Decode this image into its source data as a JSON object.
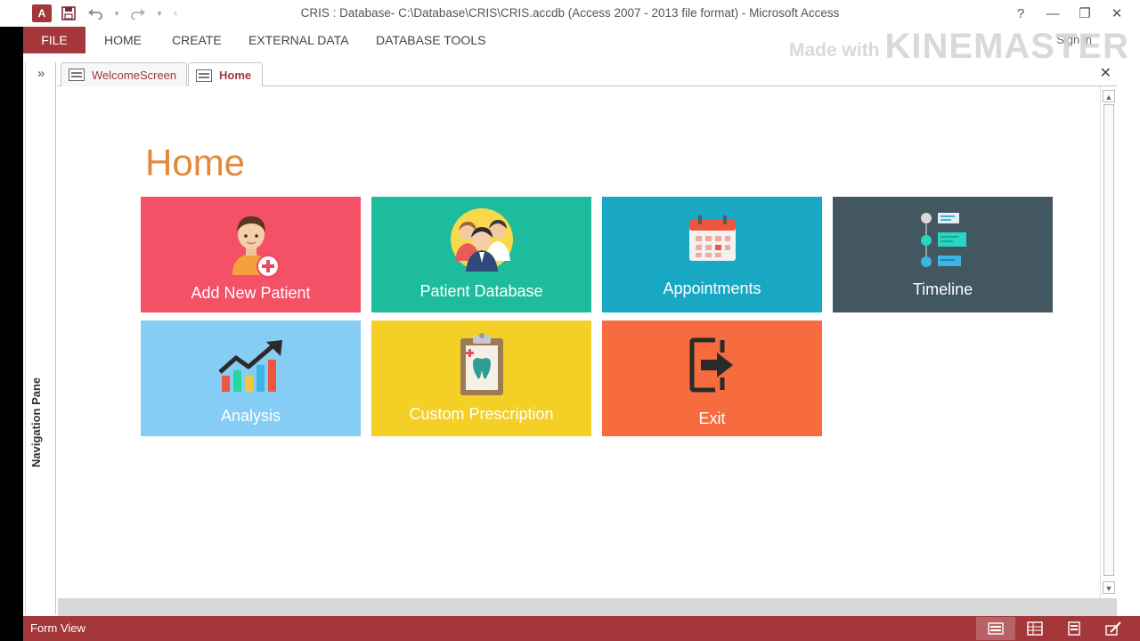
{
  "window": {
    "title": "CRIS : Database- C:\\Database\\CRIS\\CRIS.accdb (Access 2007 - 2013 file format) - Microsoft Access",
    "app_icon_text": "A",
    "help": "?",
    "minimize": "—",
    "restore": "❐",
    "close": "✕"
  },
  "ribbon": {
    "tabs": [
      "FILE",
      "HOME",
      "CREATE",
      "EXTERNAL DATA",
      "DATABASE TOOLS"
    ],
    "sign_in": "Sign in"
  },
  "watermark": {
    "small": "Made with",
    "big": "KINEMASTER"
  },
  "nav_pane": {
    "toggle": "»",
    "label": "Navigation Pane"
  },
  "doc_tabs": [
    {
      "label": "WelcomeScreen",
      "active": false
    },
    {
      "label": "Home",
      "active": true
    }
  ],
  "doc_close": "✕",
  "form": {
    "title": "Home",
    "tiles": [
      {
        "label": "Add New Patient",
        "color": "#f45066",
        "icon": "add-patient-icon"
      },
      {
        "label": "Patient Database",
        "color": "#1dbc9c",
        "icon": "patient-group-icon"
      },
      {
        "label": "Appointments",
        "color": "#19a8c3",
        "icon": "calendar-icon"
      },
      {
        "label": "Timeline",
        "color": "#435761",
        "icon": "timeline-icon"
      },
      {
        "label": "Analysis",
        "color": "#85cdf5",
        "icon": "growth-chart-icon"
      },
      {
        "label": "Custom Prescription",
        "color": "#f4d027",
        "icon": "prescription-clipboard-icon"
      },
      {
        "label": "Exit",
        "color": "#f76c3e",
        "icon": "exit-door-icon"
      }
    ]
  },
  "status": {
    "text": "Form View"
  },
  "colors": {
    "accent": "#a4373a",
    "title": "#e08a3c"
  }
}
